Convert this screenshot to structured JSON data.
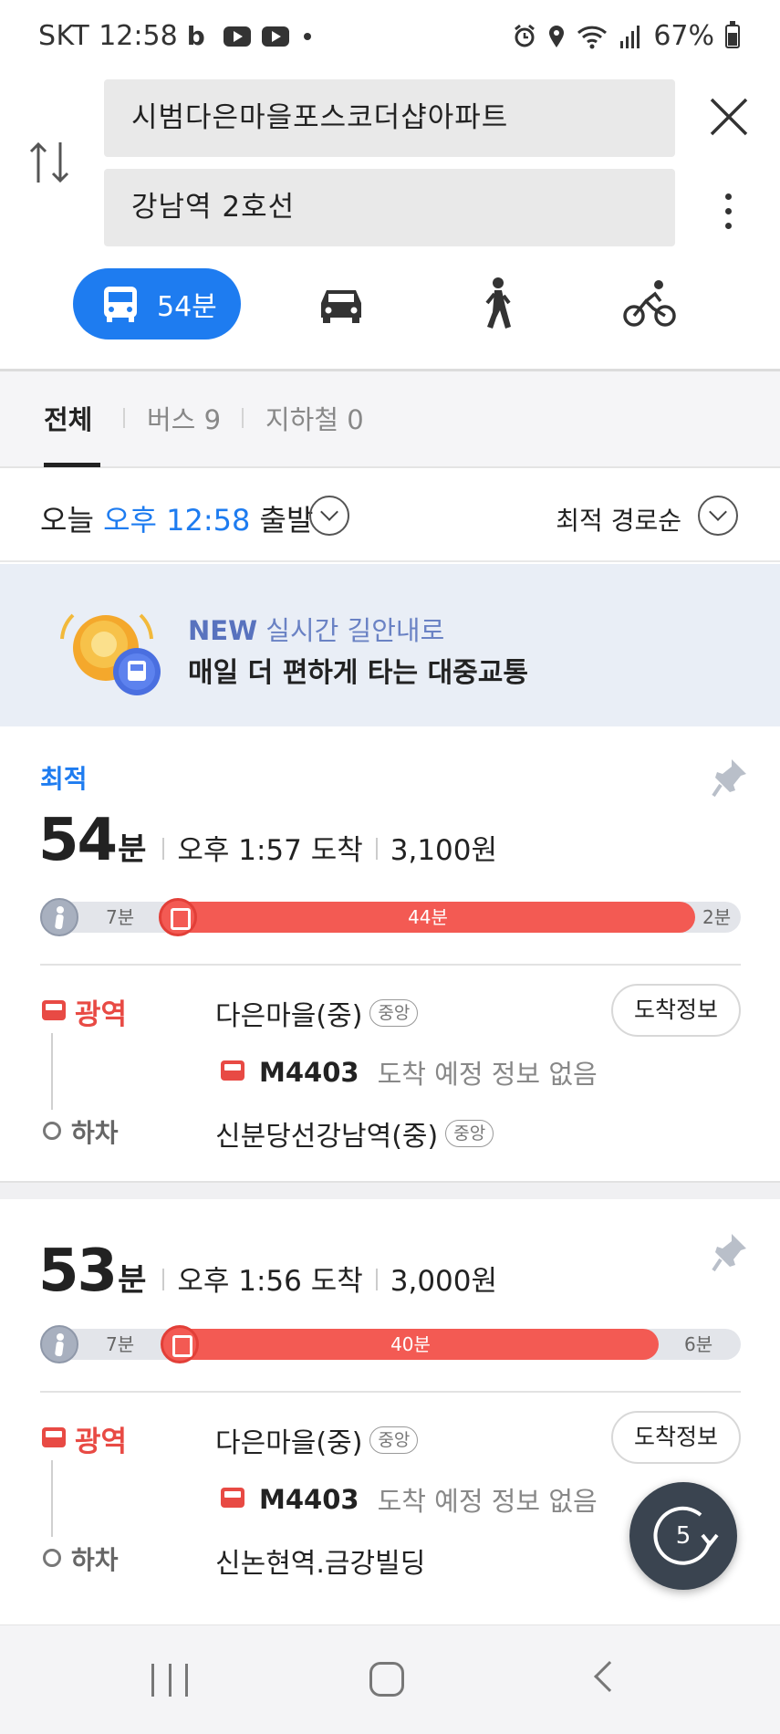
{
  "status_bar": {
    "carrier": "SKT",
    "time": "12:58",
    "battery": "67%"
  },
  "search": {
    "origin": "시범다은마을포스코더샵아파트",
    "destination": "강남역 2호선"
  },
  "modes": {
    "bus_time": "54분",
    "selected": "transit",
    "icons": [
      "bus-icon",
      "car-icon",
      "walk-icon",
      "bike-icon"
    ]
  },
  "filters": {
    "all": "전체",
    "bus": "버스 9",
    "subway": "지하철 0"
  },
  "depart": {
    "prefix": "오늘",
    "time": "오후 12:58",
    "suffix": "출발",
    "sort": "최적 경로순"
  },
  "banner": {
    "new": "NEW",
    "line1": "실시간 길안내로",
    "line2": "매일 더 편하게 타는 대중교통"
  },
  "routes": [
    {
      "badge": "최적",
      "duration": "54",
      "duration_unit": "분",
      "arrival": "오후 1:57 도착",
      "fare": "3,100원",
      "bar": {
        "walk_before": "7분",
        "bus": "44분",
        "walk_after": "2분"
      },
      "line_type": "광역",
      "board_stop": "다은마을(중)",
      "board_tag": "중앙",
      "bus_number": "M4403",
      "bus_status": "도착 예정 정보 없음",
      "alight_label": "하차",
      "alight_stop": "신분당선강남역(중)",
      "alight_tag": "중앙",
      "arrival_button": "도착정보"
    },
    {
      "duration": "53",
      "duration_unit": "분",
      "arrival": "오후 1:56 도착",
      "fare": "3,000원",
      "bar": {
        "walk_before": "7분",
        "bus": "40분",
        "walk_after": "6분"
      },
      "line_type": "광역",
      "board_stop": "다은마을(중)",
      "board_tag": "중앙",
      "bus_number": "M4403",
      "bus_status": "도착 예정 정보 없음",
      "alight_label": "하차",
      "alight_stop": "신논현역.금강빌딩",
      "arrival_button": "도착정보"
    }
  ],
  "fab": {
    "count": "5"
  },
  "colors": {
    "accent_blue": "#1e7cf0",
    "bus_red": "#f35a53",
    "banner_bg": "#e9eef6"
  }
}
